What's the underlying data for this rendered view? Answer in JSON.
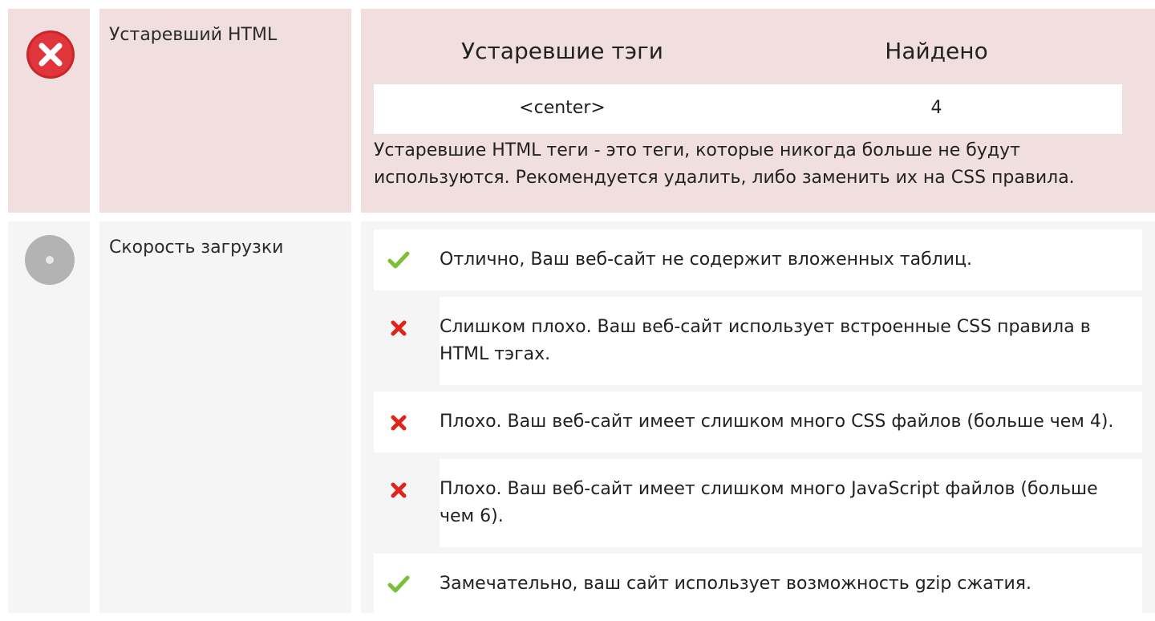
{
  "deprecated_html": {
    "label": "Устаревший HTML",
    "status": "error",
    "status_icon": "error-x-icon",
    "table": {
      "headers": [
        "Устаревшие тэги",
        "Найдено"
      ],
      "rows": [
        {
          "tag": "<center>",
          "count": "4"
        }
      ]
    },
    "description": "Устаревшие HTML теги - это теги, которые никогда больше не будут используются. Рекомендуется удалить, либо заменить их на CSS правила."
  },
  "load_speed": {
    "label": "Скорость загрузки",
    "status": "neutral",
    "status_icon": "neutral-circle-icon",
    "items": [
      {
        "status": "pass",
        "icon": "check-icon",
        "text": "Отлично, Ваш веб-сайт не содержит вложенных таблиц."
      },
      {
        "status": "fail",
        "icon": "cross-icon",
        "text": "Слишком плохо. Ваш веб-сайт использует встроенные CSS правила в HTML тэгах."
      },
      {
        "status": "fail",
        "icon": "cross-icon",
        "text": "Плохо. Ваш веб-сайт имеет слишком много CSS файлов (больше чем 4)."
      },
      {
        "status": "fail",
        "icon": "cross-icon",
        "text": "Плохо. Ваш веб-сайт имеет слишком много JavaScript файлов (больше чем 6)."
      },
      {
        "status": "pass",
        "icon": "check-icon",
        "text": "Замечательно, ваш сайт использует возможность gzip сжатия."
      }
    ]
  },
  "colors": {
    "error_bg": "#f1dfe0",
    "neutral_bg": "#f5f5f5",
    "error_icon": "#e0353a",
    "neutral_icon": "#b3b3b3",
    "check": "#7cbf3a",
    "cross": "#e0241b"
  }
}
